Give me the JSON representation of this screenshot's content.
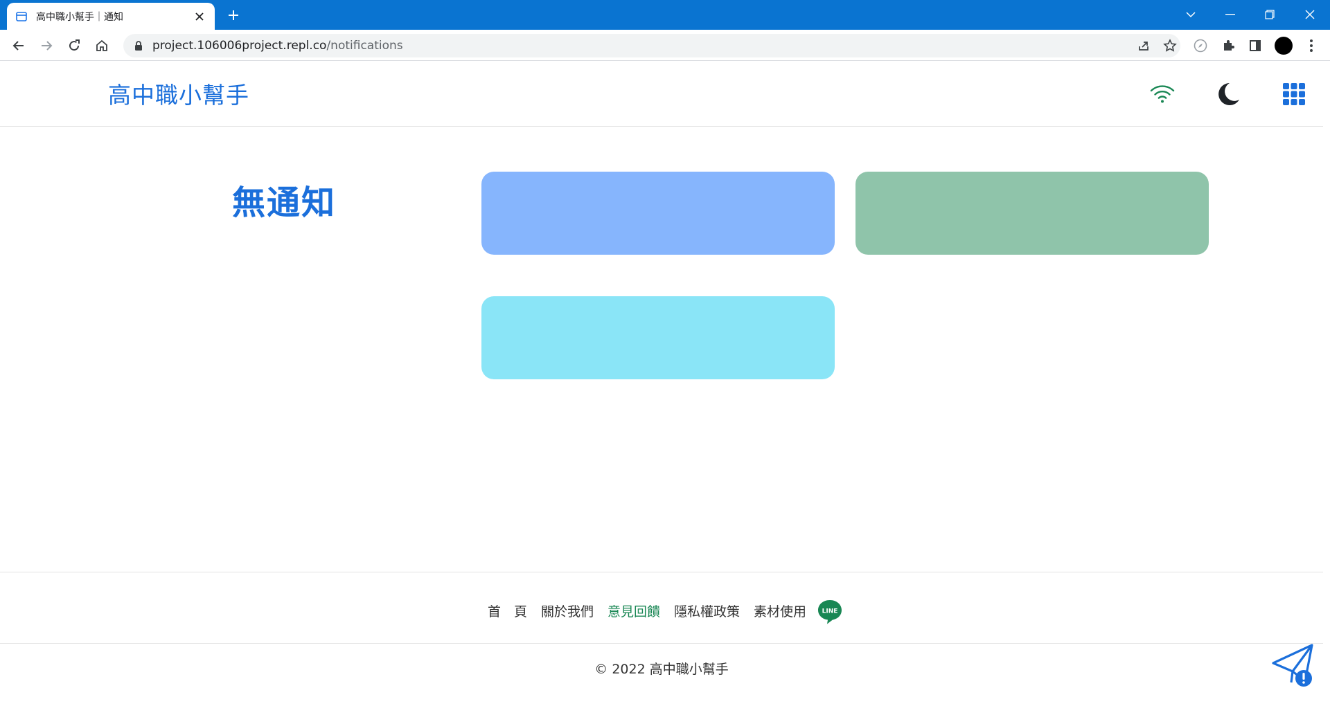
{
  "browser": {
    "tab_title": "高中職小幫手｜通知",
    "url_host": "project.106006project.repl.co",
    "url_path": "/notifications"
  },
  "header": {
    "brand": "高中職小幫手",
    "icons": [
      "wifi-icon",
      "moon-icon",
      "apps-grid-icon"
    ]
  },
  "main": {
    "empty_title": "無通知",
    "cards": [
      {
        "color": "#86b5fd"
      },
      {
        "color": "#8fc4aa"
      },
      {
        "color": "#8ae5f7"
      }
    ]
  },
  "footer": {
    "links": [
      {
        "label": "首　頁",
        "active": false
      },
      {
        "label": "關於我們",
        "active": false
      },
      {
        "label": "意見回饋",
        "active": true
      },
      {
        "label": "隱私權政策",
        "active": false
      },
      {
        "label": "素材使用",
        "active": false
      }
    ],
    "line_badge": "LINE",
    "copyright": "© 2022 高中職小幫手"
  },
  "colors": {
    "brand_blue": "#1b6fdb",
    "chrome_blue": "#0a74d1",
    "success_green": "#198754"
  }
}
